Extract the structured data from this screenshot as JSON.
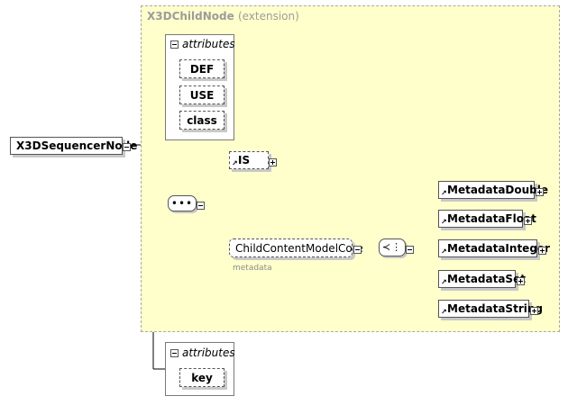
{
  "root": {
    "label": "X3DSequencerNode"
  },
  "extension": {
    "name": "X3DChildNode",
    "qualifier": "(extension)"
  },
  "attributes_top": {
    "heading": "attributes",
    "items": [
      "DEF",
      "USE",
      "class"
    ]
  },
  "attributes_bottom": {
    "heading": "attributes",
    "items": [
      "key"
    ]
  },
  "sequence": {
    "symbol": "•••"
  },
  "is_node": {
    "label": "IS"
  },
  "group": {
    "label": "ChildContentModelCore",
    "caption": "metadata"
  },
  "choice": {
    "symbol": "≺⋮"
  },
  "choices": [
    "MetadataDouble",
    "MetadataFloat",
    "MetadataInteger",
    "MetadataSet",
    "MetadataString"
  ],
  "colors": {
    "extension_bg": "#ffffcc",
    "line": "#000000",
    "dashed_border": "#a8a8a8"
  }
}
